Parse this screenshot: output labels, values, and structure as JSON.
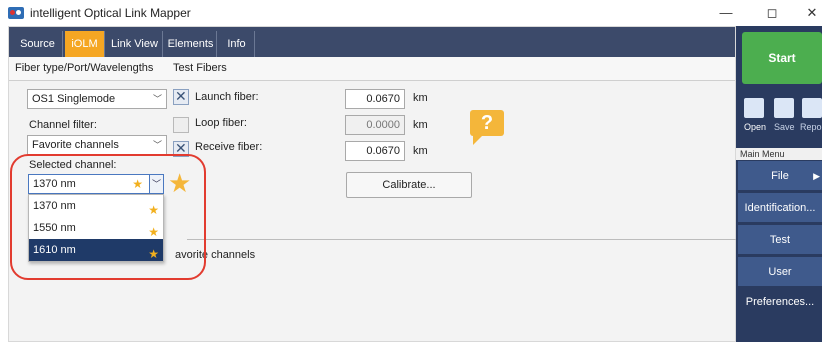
{
  "window": {
    "title": "intelligent Optical Link Mapper",
    "min": "—",
    "restore": "◻",
    "close": "✕"
  },
  "tabs": [
    {
      "label": "Source"
    },
    {
      "label": "iOLM"
    },
    {
      "label": "Link View"
    },
    {
      "label": "Elements"
    },
    {
      "label": "Info"
    }
  ],
  "subtabs": [
    "Fiber type/Port/Wavelengths",
    "Test Fibers"
  ],
  "fiber_type": {
    "value": "OS1 Singlemode"
  },
  "channel_filter": {
    "label": "Channel filter:",
    "value": "Favorite channels"
  },
  "selected_channel": {
    "label": "Selected channel:",
    "value": "1370 nm"
  },
  "channel_options": [
    {
      "label": "1370 nm",
      "selected": false
    },
    {
      "label": "1550 nm",
      "selected": false
    },
    {
      "label": "1610 nm",
      "selected": true
    }
  ],
  "fibers": {
    "launch": {
      "label": "Launch fiber:",
      "value": "0.0670",
      "unit": "km",
      "checked": true
    },
    "loop": {
      "label": "Loop fiber:",
      "value": "0.0000",
      "unit": "km",
      "checked": false
    },
    "receive": {
      "label": "Receive fiber:",
      "value": "0.0670",
      "unit": "km",
      "checked": true
    }
  },
  "calibrate": {
    "label": "Calibrate..."
  },
  "favorite_text": "avorite channels",
  "help_icon": "?",
  "star_glyph": "★",
  "right_panel": {
    "start": "Start",
    "tools": [
      "Open",
      "Save",
      "Repo"
    ],
    "menu_header": "Main Menu",
    "menu_items": [
      "File",
      "Identification...",
      "Test Configuration...",
      "User Preferences..."
    ],
    "file_arrow": "▶"
  },
  "colors": {
    "tab_active": "#f5a623",
    "tab_bar": "#3c4a6a",
    "start": "#4cae4f",
    "selection": "#1f3a68",
    "highlight_outline": "#e23b2f",
    "star": "#f4b63a"
  }
}
